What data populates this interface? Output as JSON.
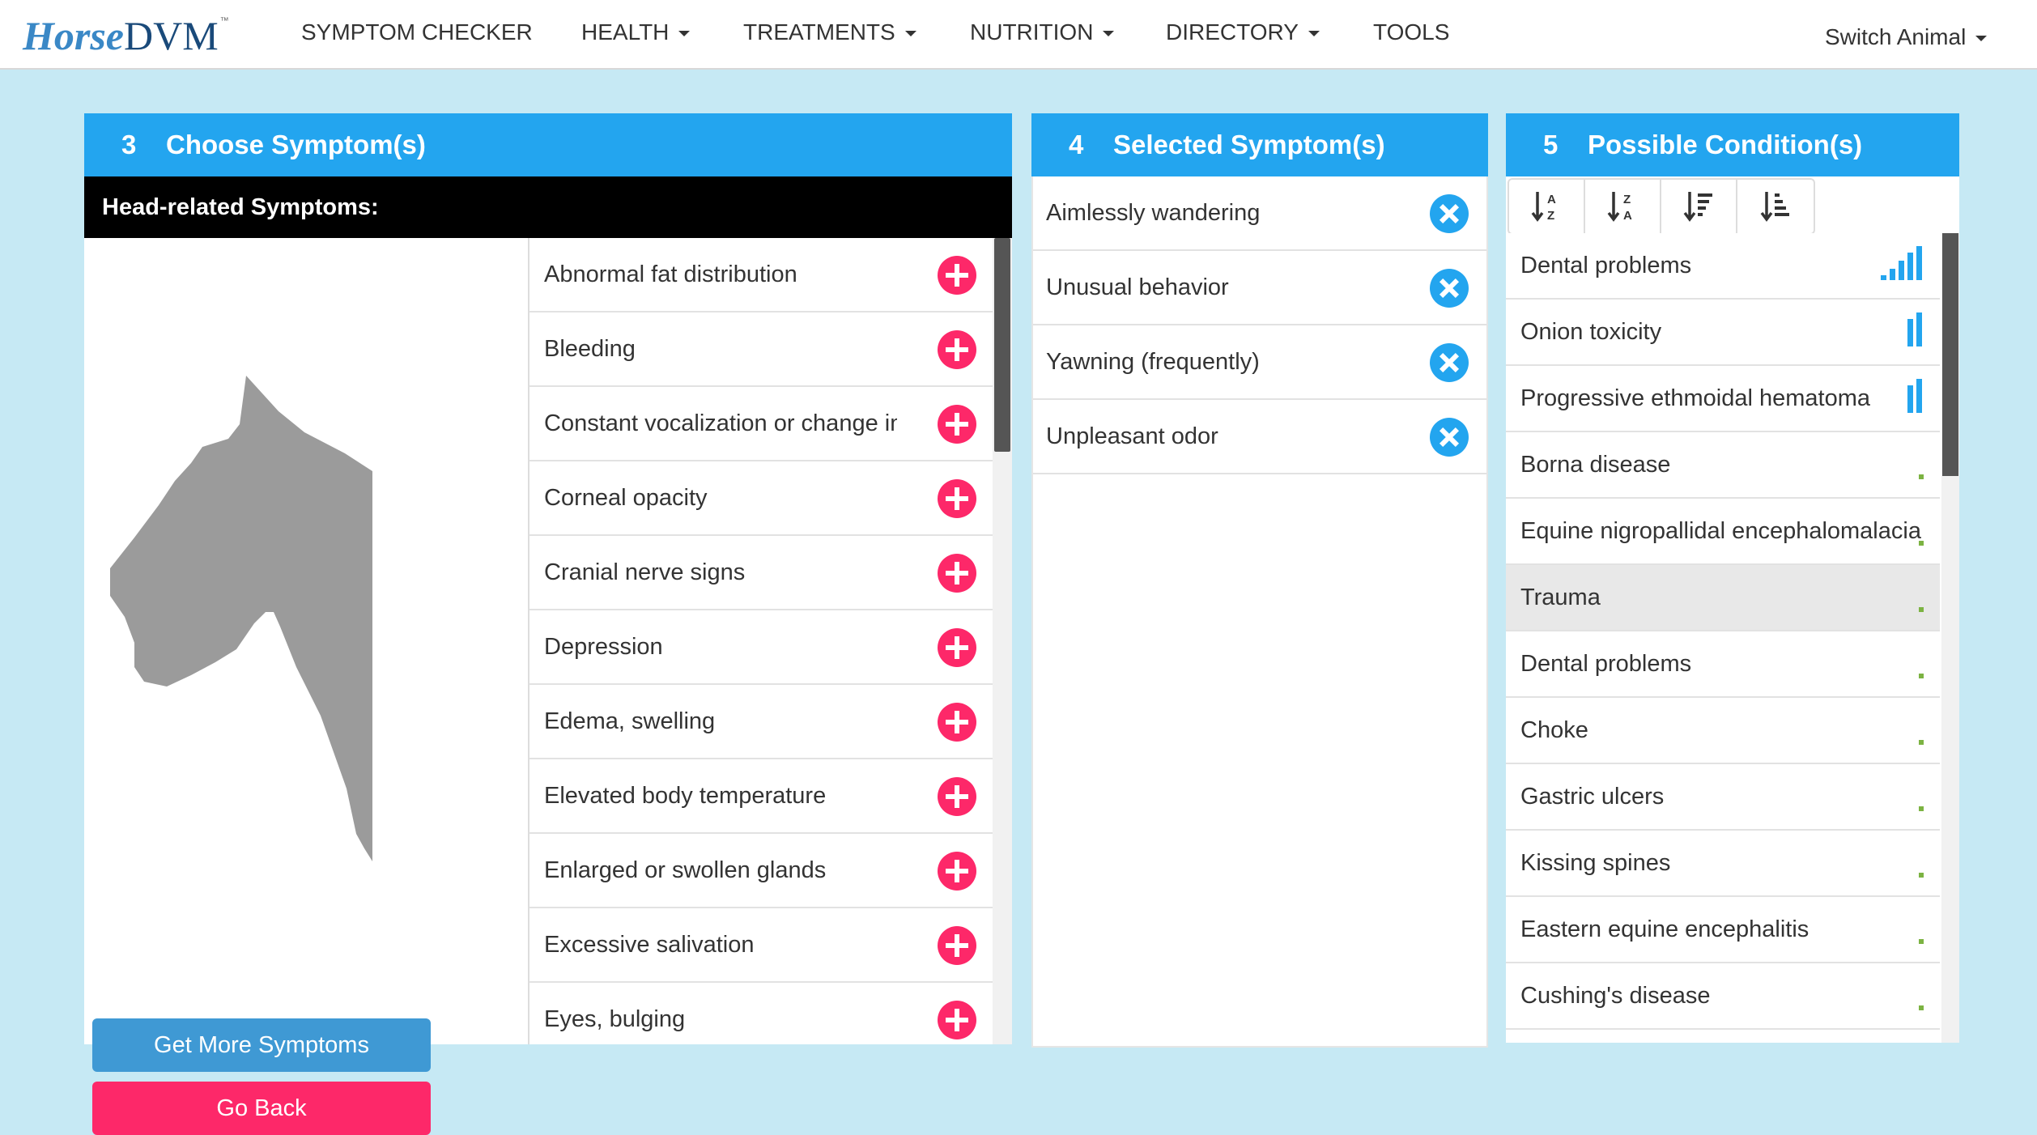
{
  "brand": {
    "name_part1": "Horse",
    "name_part2": "DVM",
    "trademark": "™"
  },
  "nav": {
    "items": [
      {
        "label": "SYMPTOM CHECKER",
        "dropdown": false
      },
      {
        "label": "HEALTH",
        "dropdown": true
      },
      {
        "label": "TREATMENTS",
        "dropdown": true
      },
      {
        "label": "NUTRITION",
        "dropdown": true
      },
      {
        "label": "DIRECTORY",
        "dropdown": true
      },
      {
        "label": "TOOLS",
        "dropdown": false
      }
    ],
    "switch_animal": "Switch Animal"
  },
  "choose": {
    "step": "3",
    "title": "Choose Symptom(s)",
    "subhead": "Head-related Symptoms:",
    "symptoms": [
      "Abnormal fat distribution",
      "Bleeding",
      "Constant vocalization or change in",
      "Corneal opacity",
      "Cranial nerve signs",
      "Depression",
      "Edema, swelling",
      "Elevated body temperature",
      "Enlarged or swollen glands",
      "Excessive salivation",
      "Eyes, bulging"
    ],
    "more_button": "Get More Symptoms",
    "back_button": "Go Back"
  },
  "selected": {
    "step": "4",
    "title": "Selected Symptom(s)",
    "items": [
      "Aimlessly wandering",
      "Unusual behavior",
      "Yawning (frequently)",
      "Unpleasant odor"
    ]
  },
  "conditions": {
    "step": "5",
    "title": "Possible Condition(s)",
    "sort_icons": [
      "sort-alpha-asc-icon",
      "sort-alpha-desc-icon",
      "sort-amount-desc-icon",
      "sort-amount-asc-icon"
    ],
    "items": [
      {
        "name": "Dental problems",
        "likelihood_level": 4
      },
      {
        "name": "Onion toxicity",
        "likelihood_level": 1
      },
      {
        "name": "Progressive ethmoidal hematoma",
        "likelihood_level": 1
      },
      {
        "name": "Borna disease",
        "likelihood_level": 0
      },
      {
        "name": "Equine nigropallidal encephalomalacia",
        "likelihood_level": 0
      },
      {
        "name": "Trauma",
        "likelihood_level": 0,
        "highlighted": true
      },
      {
        "name": "Dental problems",
        "likelihood_level": 0
      },
      {
        "name": "Choke",
        "likelihood_level": 0
      },
      {
        "name": "Gastric ulcers",
        "likelihood_level": 0
      },
      {
        "name": "Kissing spines",
        "likelihood_level": 0
      },
      {
        "name": "Eastern equine encephalitis",
        "likelihood_level": 0
      },
      {
        "name": "Cushing's disease",
        "likelihood_level": 0
      }
    ]
  },
  "colors": {
    "accent_blue": "#23a5ef",
    "add_pink": "#fd2869",
    "page_bg": "#c6e9f4",
    "meter_low": "#7cb342"
  }
}
